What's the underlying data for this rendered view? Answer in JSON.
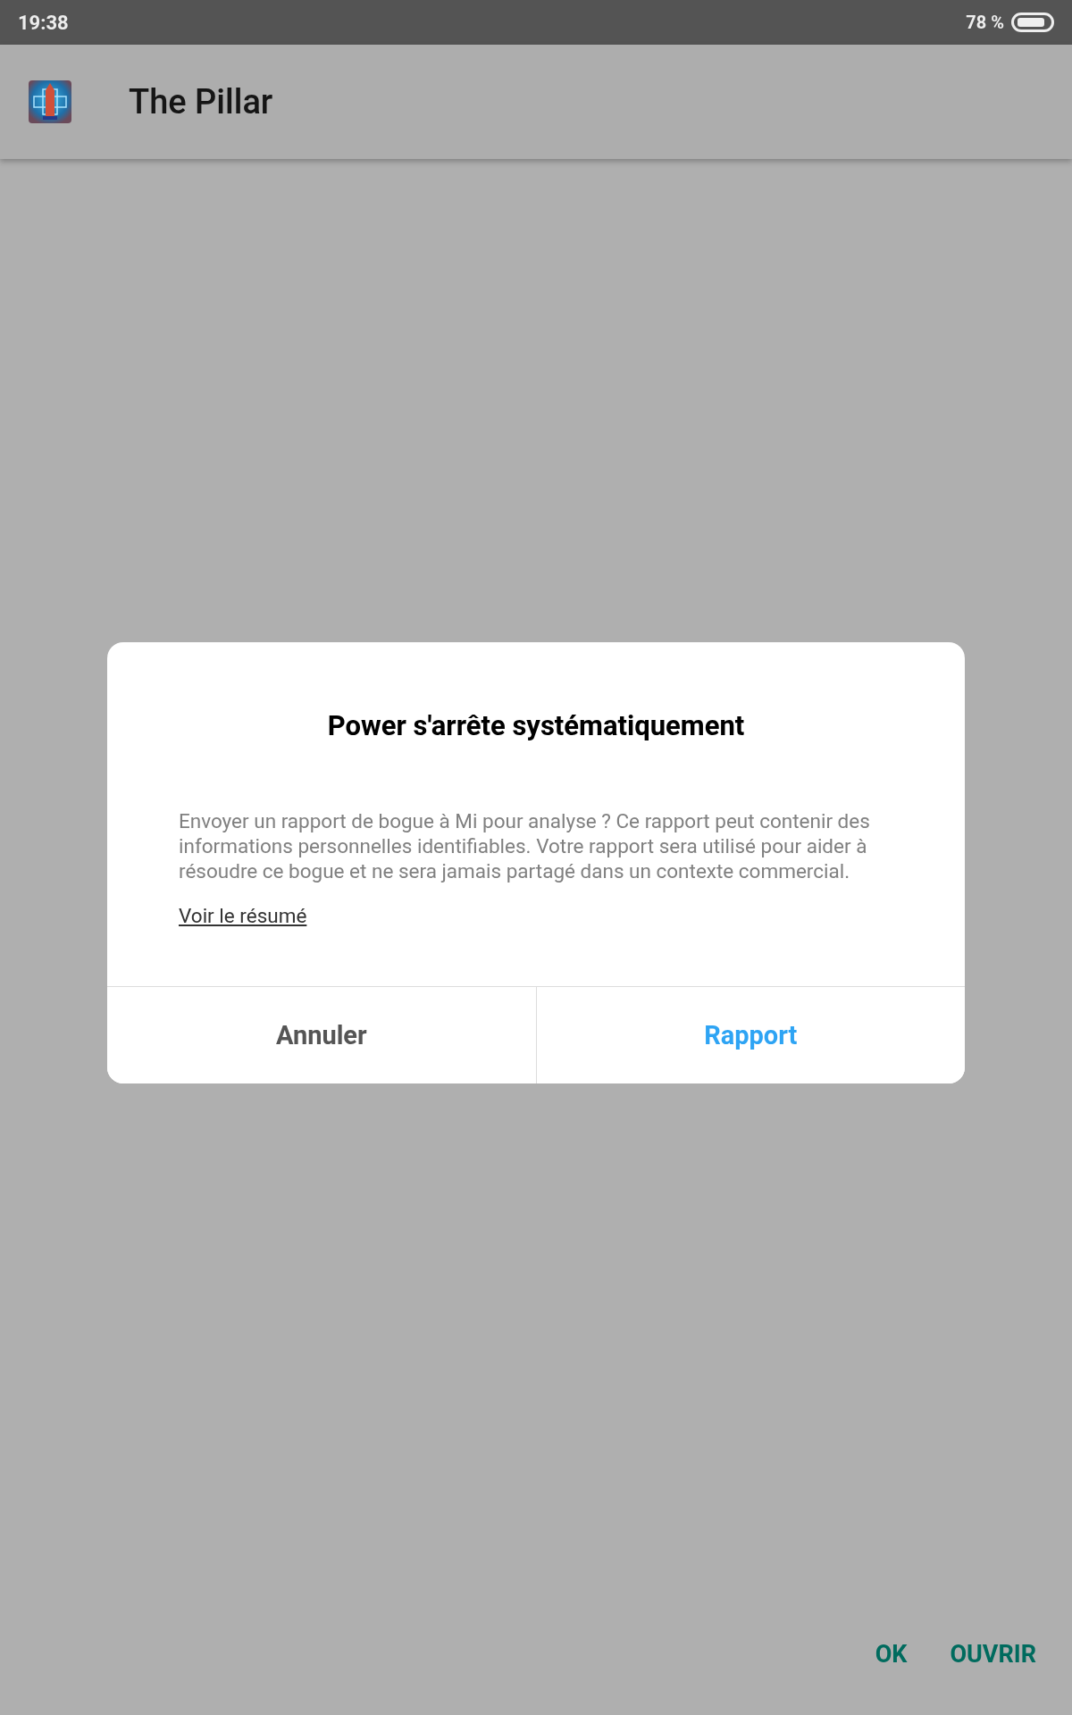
{
  "status_bar": {
    "time": "19:38",
    "battery": "78 %"
  },
  "app_bar": {
    "title": "The Pillar"
  },
  "dialog": {
    "title": "Power s'arrête systématiquement",
    "message": "Envoyer un rapport de bogue à Mi pour analyse ? Ce rapport peut contenir des informations personnelles identifiables. Votre rapport sera utilisé pour aider à résoudre ce bogue et ne sera jamais partagé dans un contexte commercial.",
    "link": "Voir le résumé",
    "buttons": [
      {
        "label": "Annuler",
        "kind": "neutral"
      },
      {
        "label": "Rapport",
        "kind": "primary"
      }
    ]
  },
  "bottom_actions": [
    "OK",
    "OUVRIR"
  ]
}
